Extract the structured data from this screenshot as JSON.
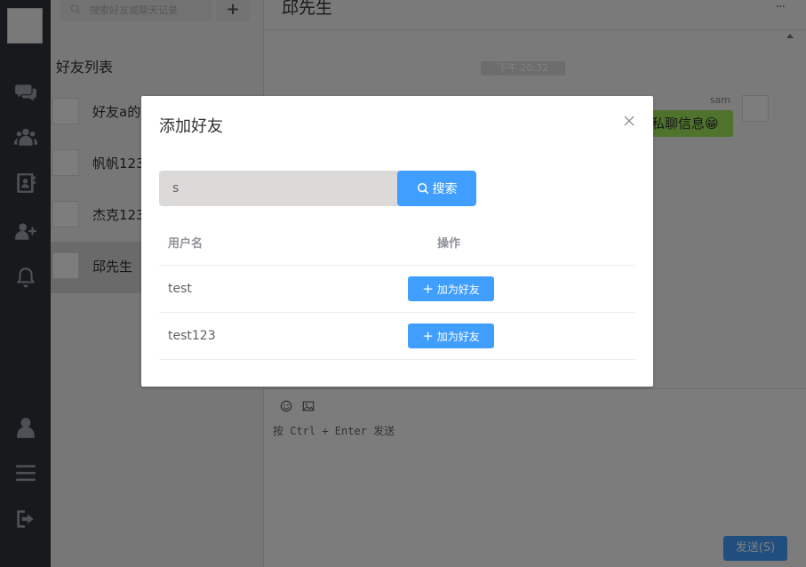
{
  "sidebar": {
    "search_placeholder": "搜索好友或聊天记录",
    "add_button": "+",
    "friend_list_title": "好友列表",
    "friends": [
      {
        "name": "好友a的"
      },
      {
        "name": "帆帆123"
      },
      {
        "name": "杰克123"
      },
      {
        "name": "邱先生"
      }
    ]
  },
  "chat": {
    "title": "邱先生",
    "more": "···",
    "time": "下午 20:32",
    "sender": "sam",
    "message": "私聊信息😁",
    "input_hint": "按 Ctrl + Enter 发送",
    "send_label": "发送(S)"
  },
  "modal": {
    "title": "添加好友",
    "search_value": "s",
    "search_label": "搜索",
    "columns": [
      "用户名",
      "操作"
    ],
    "rows": [
      {
        "username": "test",
        "action": "加为好友"
      },
      {
        "username": "test123",
        "action": "加为好友"
      }
    ]
  }
}
